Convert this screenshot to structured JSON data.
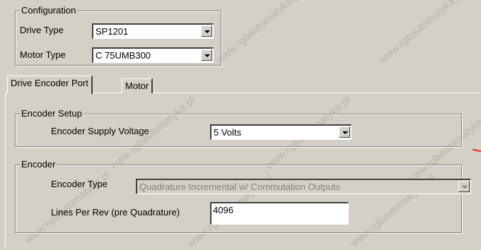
{
  "configuration": {
    "title": "Configuration",
    "drive_type_label": "Drive Type",
    "drive_type_value": "SP1201",
    "motor_type_label": "Motor Type",
    "motor_type_value": "C 75UMB300"
  },
  "tabs": [
    {
      "label": "Drive Encoder Port",
      "active": true
    },
    {
      "label": "Motor",
      "active": false
    }
  ],
  "encoder_setup": {
    "title": "Encoder Setup",
    "supply_voltage_label": "Encoder Supply Voltage",
    "supply_voltage_value": "5 Volts"
  },
  "encoder": {
    "title": "Encoder",
    "type_label": "Encoder Type",
    "type_value": "Quadrature Incremental w/ Commutation Outputs",
    "lines_label": "Lines Per Rev (pre Quadrature)",
    "lines_value": "4096"
  },
  "watermark_text": "www.rgbautomatyka.pl",
  "colors": {
    "window_bg": "#d4d0c8",
    "field_bg": "#ffffff",
    "disabled_text": "#808080",
    "accent_line": "#e0281e"
  }
}
